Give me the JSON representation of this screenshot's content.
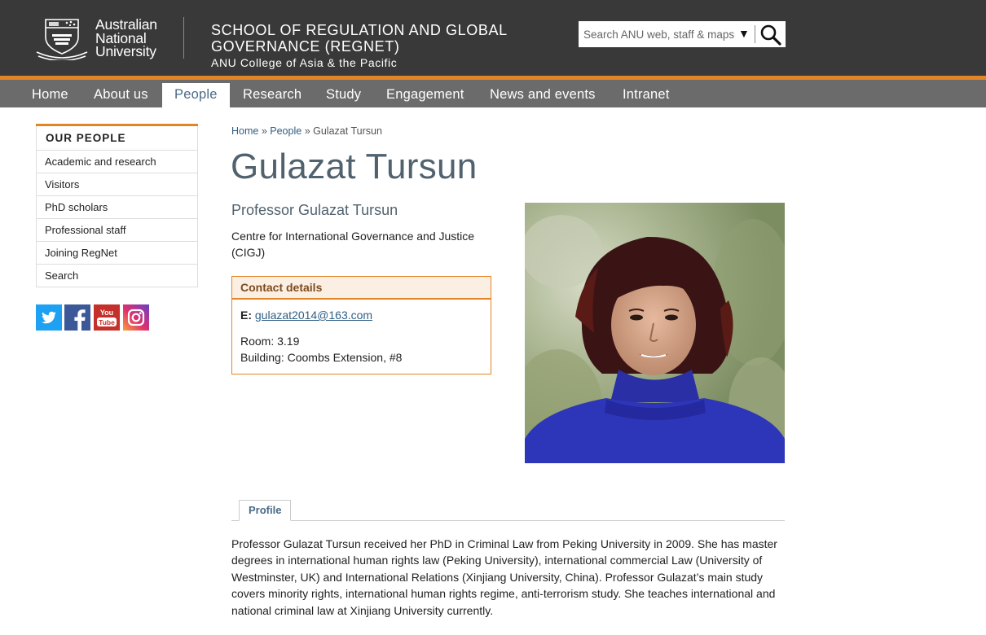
{
  "header": {
    "university_name": [
      "Australian",
      "National",
      "University"
    ],
    "site_title_line1": "SCHOOL OF REGULATION AND GLOBAL",
    "site_title_line2": "GOVERNANCE (REGNET)",
    "college": "ANU College of Asia & the Pacific",
    "search": {
      "placeholder": "Search ANU web, staff & maps",
      "dropdown_glyph": "▼",
      "button_icon": "search-icon"
    }
  },
  "colors": {
    "header_bg": "#393939",
    "accent": "#e18526",
    "nav_bg": "#6b6b6b",
    "title": "#51626f",
    "link": "#2f5f84"
  },
  "nav": {
    "items": [
      {
        "label": "Home"
      },
      {
        "label": "About us"
      },
      {
        "label": "People",
        "active": true
      },
      {
        "label": "Research"
      },
      {
        "label": "Study"
      },
      {
        "label": "Engagement"
      },
      {
        "label": "News and events"
      },
      {
        "label": "Intranet"
      }
    ]
  },
  "sidebar": {
    "heading": "OUR PEOPLE",
    "items": [
      {
        "label": "Academic and research"
      },
      {
        "label": "Visitors"
      },
      {
        "label": "PhD scholars"
      },
      {
        "label": "Professional staff"
      },
      {
        "label": "Joining RegNet"
      },
      {
        "label": "Search"
      }
    ],
    "social": [
      "twitter-icon",
      "facebook-icon",
      "youtube-icon",
      "instagram-icon"
    ],
    "youtube_text": [
      "You",
      "Tube"
    ]
  },
  "breadcrumb": {
    "home": "Home",
    "sep": "»",
    "people": "People",
    "current": "Gulazat Tursun"
  },
  "profile": {
    "name": "Gulazat Tursun",
    "title": "Professor Gulazat Tursun",
    "centre": "Centre for International Governance and Justice (CIGJ)",
    "contact": {
      "heading": "Contact details",
      "email_label": "E:",
      "email": "gulazat2014@163.com",
      "room": "Room: 3.19",
      "building": "Building: Coombs Extension, #8"
    },
    "tab": "Profile",
    "bio": "Professor Gulazat Tursun received her PhD in Criminal Law from Peking University in 2009. She has master degrees in international human rights law (Peking University), international commercial Law (University of Westminster, UK) and International Relations (Xinjiang University, China). Professor Gulazat’s main study covers minority rights, international human rights regime, anti-terrorism study. She teaches international and national criminal law at Xinjiang University currently."
  }
}
